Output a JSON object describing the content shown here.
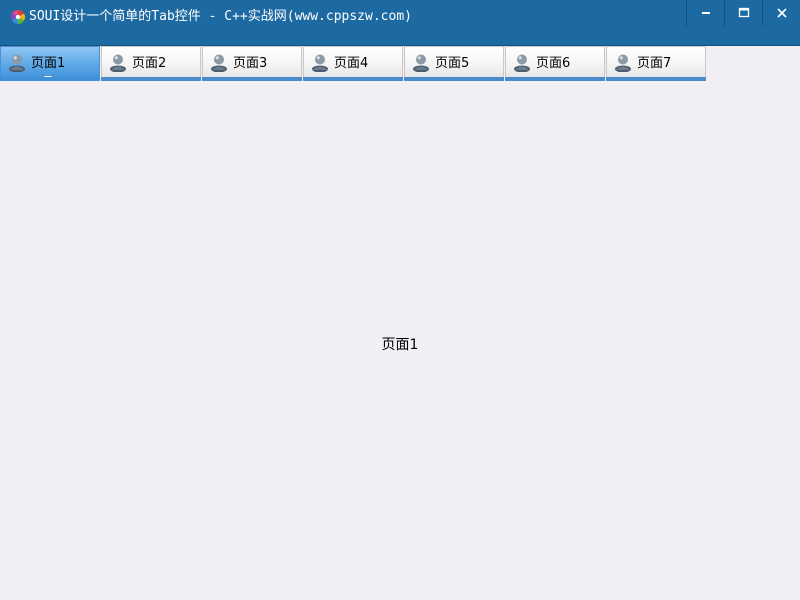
{
  "window": {
    "title": "SOUI设计一个简单的Tab控件 - C++实战网(www.cppszw.com)",
    "icon": "app-palette-icon"
  },
  "caption_buttons": [
    {
      "name": "minimize",
      "icon": "minimize-icon"
    },
    {
      "name": "maximize",
      "icon": "maximize-icon"
    },
    {
      "name": "close",
      "icon": "close-icon"
    }
  ],
  "tabs": {
    "items": [
      {
        "label": "页面1",
        "active": true,
        "icon": "user-icon"
      },
      {
        "label": "页面2",
        "active": false,
        "icon": "user-icon"
      },
      {
        "label": "页面3",
        "active": false,
        "icon": "user-icon"
      },
      {
        "label": "页面4",
        "active": false,
        "icon": "user-icon"
      },
      {
        "label": "页面5",
        "active": false,
        "icon": "user-icon"
      },
      {
        "label": "页面6",
        "active": false,
        "icon": "user-icon"
      },
      {
        "label": "页面7",
        "active": false,
        "icon": "user-icon"
      }
    ]
  },
  "content": {
    "text": "页面1"
  },
  "colors": {
    "titlebar": "#1d6aa3",
    "active_tab": "#5aa6e6",
    "tab_underline": "#4a8ccb",
    "background": "#f1eff4"
  }
}
